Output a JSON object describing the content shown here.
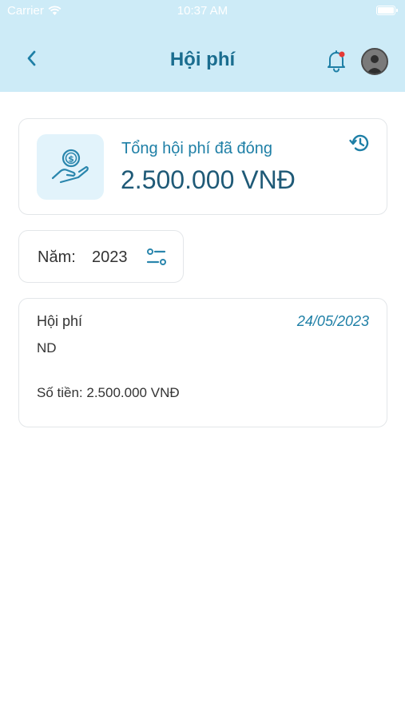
{
  "status_bar": {
    "carrier": "Carrier",
    "time": "10:37 AM"
  },
  "header": {
    "title": "Hội phí"
  },
  "summary": {
    "label": "Tổng hội phí đã đóng",
    "amount": "2.500.000 VNĐ"
  },
  "filter": {
    "label": "Năm:",
    "year": "2023"
  },
  "records": [
    {
      "title": "Hội phí",
      "date": "24/05/2023",
      "note": "ND",
      "amount": "Số tiền: 2.500.000 VNĐ"
    }
  ],
  "colors": {
    "header_bg": "#cdebf7",
    "accent": "#1e7fa6",
    "title": "#1a6d8f",
    "notification_dot": "#e53935"
  },
  "icons": {
    "back": "chevron-left-icon",
    "notification": "bell-icon",
    "history": "history-icon",
    "summary": "hand-coin-icon",
    "filter": "filter-sliders-icon"
  }
}
